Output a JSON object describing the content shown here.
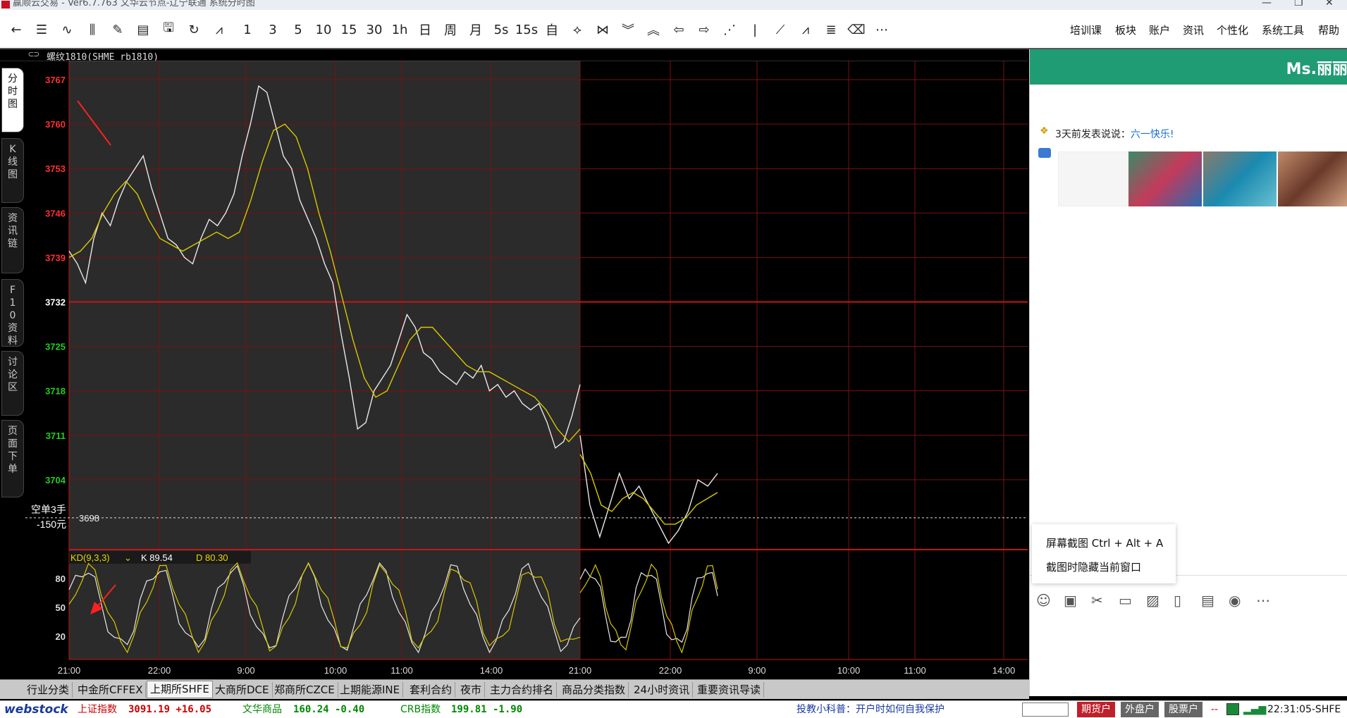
{
  "window": {
    "title": "赢顺云交易  -  Ver6.7.763      文华云节点-辽宁联通      系统分时图"
  },
  "toolbar": {
    "icons": [
      "back-icon",
      "list-icon",
      "line-chart-icon",
      "candlestick-icon",
      "draw-icon",
      "report-icon",
      "save-icon",
      "refresh-icon",
      "trend-icon"
    ],
    "periods": [
      "1",
      "3",
      "5",
      "10",
      "15",
      "30",
      "1h",
      "日",
      "周",
      "月",
      "5s",
      "15s",
      "自"
    ],
    "tool_icons": [
      "expand-h-icon",
      "collapse-h-icon",
      "double-down-icon",
      "double-up-icon",
      "left-arrow-icon",
      "right-arrow-icon",
      "dotted-line-icon",
      "vertical-line-icon",
      "diagonal-line-icon",
      "zigzag-icon",
      "fib-icon",
      "eraser-icon",
      "more-icon"
    ],
    "menus": [
      "培训课",
      "板块",
      "账户",
      "资讯",
      "个性化",
      "系统工具",
      "帮助"
    ]
  },
  "symbol_bar": {
    "text": "螺纹1810(SHME rb1810)"
  },
  "left_tabs": [
    {
      "label": "分时图",
      "active": true
    },
    {
      "label": "K线图",
      "active": false
    },
    {
      "label": "资讯链",
      "active": false
    },
    {
      "label": "F10资料",
      "active": false
    },
    {
      "label": "讨论区",
      "active": false
    },
    {
      "label": "页面下单",
      "active": false
    }
  ],
  "chart_data": {
    "type": "line",
    "title": "螺纹1810(SHME rb1810)",
    "x_ticks": [
      "21:00",
      "22:00",
      "9:00",
      "10:00",
      "11:00",
      "14:00",
      "21:00",
      "22:00",
      "9:00",
      "10:00",
      "11:00",
      "14:00"
    ],
    "price_ticks": [
      3767,
      3760,
      3753,
      3746,
      3739,
      3732,
      3725,
      3718,
      3711,
      3704
    ],
    "prev_close": 3732,
    "ylim": [
      3693,
      3770
    ],
    "order_line": {
      "price": 3698,
      "label": "3698",
      "side_label": "空单3手",
      "pnl_label": "-150元"
    },
    "series": [
      {
        "name": "price",
        "color": "#e8e8e8",
        "session1": [
          3740,
          3738,
          3735,
          3742,
          3746,
          3744,
          3748,
          3751,
          3753,
          3755,
          3750,
          3746,
          3742,
          3741,
          3739,
          3738,
          3742,
          3745,
          3744,
          3746,
          3749,
          3755,
          3760,
          3766,
          3765,
          3760,
          3755,
          3753,
          3748,
          3745,
          3742,
          3738,
          3735,
          3727,
          3720,
          3712,
          3713,
          3718,
          3720,
          3722,
          3726,
          3730,
          3728,
          3724,
          3723,
          3721,
          3720,
          3719,
          3721,
          3720,
          3722,
          3718,
          3719,
          3717,
          3718,
          3716,
          3715,
          3716,
          3713,
          3709,
          3710,
          3714,
          3719
        ],
        "session2": [
          3711,
          3700,
          3695,
          3700,
          3705,
          3701,
          3703,
          3700,
          3697,
          3694,
          3696,
          3699,
          3704,
          3703,
          3705
        ]
      },
      {
        "name": "avg",
        "color": "#d8c800",
        "session1": [
          3739,
          3740,
          3742,
          3746,
          3749,
          3751,
          3749,
          3745,
          3742,
          3741,
          3740,
          3741,
          3742,
          3743,
          3742,
          3743,
          3748,
          3754,
          3759,
          3760,
          3758,
          3753,
          3746,
          3740,
          3733,
          3726,
          3720,
          3717,
          3718,
          3722,
          3726,
          3728,
          3728,
          3726,
          3724,
          3722,
          3721,
          3721,
          3720,
          3719,
          3718,
          3717,
          3715,
          3712,
          3710,
          3712
        ],
        "session2": [
          3708,
          3705,
          3700,
          3699,
          3701,
          3702,
          3701,
          3699,
          3697,
          3697,
          3698,
          3700,
          3701,
          3702
        ]
      }
    ],
    "kd": {
      "label": "KD(9,3,3)",
      "k_label": "K 89.54",
      "d_label": "D 80.30",
      "ticks": [
        80,
        50,
        20
      ]
    }
  },
  "bottom_tabs": [
    {
      "label": "行业分类",
      "active": false
    },
    {
      "label": "中金所CFFEX",
      "active": false
    },
    {
      "label": "上期所SHFE",
      "active": true
    },
    {
      "label": "大商所DCE",
      "active": false
    },
    {
      "label": "郑商所CZCE",
      "active": false
    },
    {
      "label": "上期能源INE",
      "active": false
    },
    {
      "label": "套利合约",
      "active": false
    },
    {
      "label": "夜市",
      "active": false
    },
    {
      "label": "主力合约排名",
      "active": false
    },
    {
      "label": "商品分类指数",
      "active": false
    },
    {
      "label": "24小时资讯",
      "active": false
    },
    {
      "label": "重要资讯导读",
      "active": false
    }
  ],
  "status": {
    "logo": "webstock",
    "idx1_name": "上证指数",
    "idx1_value": "3091.19 +16.05",
    "idx2_name": "文华商品",
    "idx2_value": "160.24 -0.40",
    "idx3_name": "CRB指数",
    "idx3_value": "199.81 -1.90",
    "tip": "投教小科普：开户时如何自我保护",
    "btn1": "期货户",
    "btn2": "外盘户",
    "btn3": "股票户",
    "dash": "--",
    "clock": "22:31:05-SHFE"
  },
  "chat_panel": {
    "header": "Ms.丽丽",
    "post_prefix": "3天前发表说说：",
    "post_link": "六一快乐!",
    "menu_item1": "屏幕截图 Ctrl + Alt + A",
    "menu_item2": "截图时隐藏当前窗口",
    "tools": [
      "emoji-icon",
      "gif-icon",
      "scissors-icon",
      "folder-icon",
      "image-icon",
      "shake-icon",
      "clipboard-icon",
      "redpacket-icon",
      "more-icon"
    ]
  }
}
